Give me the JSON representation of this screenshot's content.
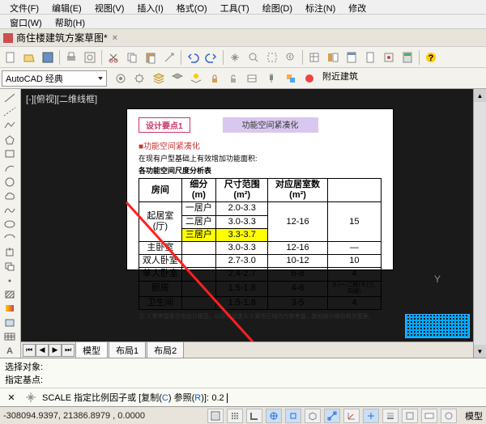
{
  "menu": {
    "items": [
      "文件(F)",
      "编辑(E)",
      "视图(V)",
      "插入(I)",
      "格式(O)",
      "工具(T)",
      "绘图(D)",
      "标注(N)",
      "修改"
    ],
    "items2": [
      "窗口(W)",
      "帮助(H)"
    ]
  },
  "tab": {
    "title": "商住楼建筑方案草图*"
  },
  "workspace": {
    "label": "AutoCAD 经典"
  },
  "nearby": "附近建筑",
  "vlabel": "[-][俯视][二维线框]",
  "paper": {
    "badge1": "设计要点1",
    "badge2": "功能空间紧凑化",
    "sub1": "■功能空间紧凑化",
    "sub2": "在现有户型基础上有效增加功能面积:",
    "sub3": "各功能空间尺度分析表",
    "th": [
      "房间",
      "细分(m)",
      "尺寸范围(m²)",
      "对应居室数(m²)"
    ],
    "rows": [
      [
        "起居室(厅)",
        "一居户",
        "2.0-3.3",
        "12-16",
        "15"
      ],
      [
        "",
        "二居户",
        "3.0-3.3",
        "",
        ""
      ],
      [
        "",
        "三居户",
        "3.3-3.7",
        "",
        ""
      ],
      [
        "主卧室",
        "",
        "3.0-3.3",
        "12-16",
        "—"
      ],
      [
        "双人卧室",
        "",
        "2.7-3.0",
        "10-12",
        "10"
      ],
      [
        "单人卧室",
        "",
        "2.4-2.7",
        "6-8",
        "4"
      ],
      [
        "厨房",
        "",
        "1.5-1.8",
        "4-6",
        "5 (一,二居)\n6 (三,四居)"
      ],
      [
        "卫生间",
        "",
        "1.5-1.8",
        "3-5",
        "4"
      ]
    ],
    "note": "注: 1.参考国家住宅设计规范，以获得适宜人  2.黄色区域内为参考值，其他部分摘自相关图表。"
  },
  "btabs": {
    "tabs": [
      "模型",
      "布局1",
      "布局2"
    ]
  },
  "cmd": {
    "l1": "选择对象:",
    "l2": "指定基点:",
    "prompt": "SCALE 指定比例因子或 [复制(C) 参照(R)]:",
    "input": "0.2"
  },
  "status": {
    "coords": "-308094.9397, 21386.8979 , 0.0000",
    "model": "模型"
  },
  "axis": "Y"
}
